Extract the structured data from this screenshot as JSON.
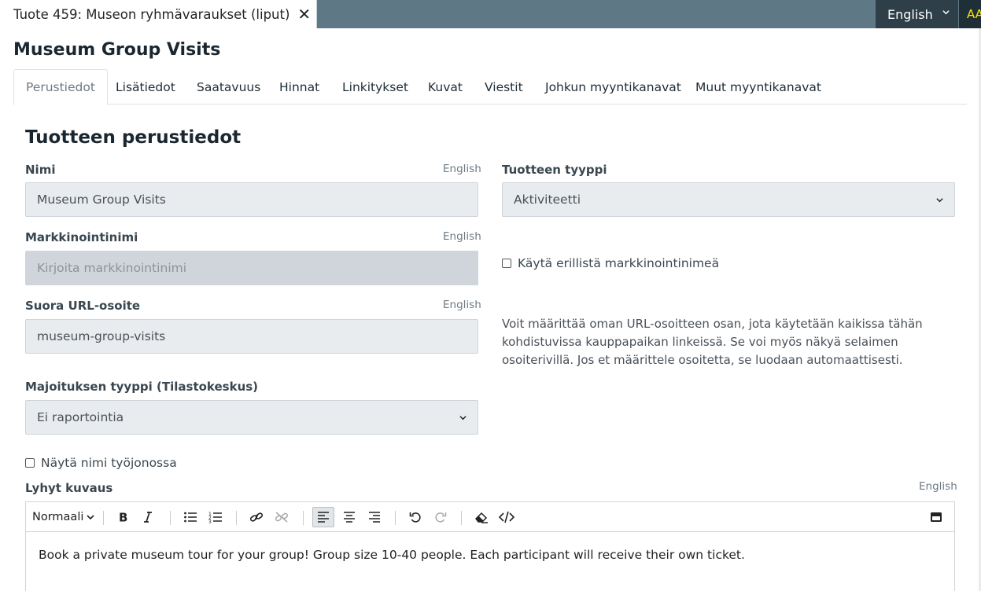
{
  "window": {
    "tab_title": "Tuote 459: Museon ryhmävaraukset (liput)",
    "tab_close_icon": "close-icon",
    "language": "English",
    "user_initials": "AA"
  },
  "page": {
    "title": "Museum Group Visits",
    "tabs": [
      {
        "label": "Perustiedot",
        "active": true
      },
      {
        "label": "Lisätiedot"
      },
      {
        "label": "Saatavuus"
      },
      {
        "label": "Hinnat"
      },
      {
        "label": "Linkitykset"
      },
      {
        "label": "Kuvat"
      },
      {
        "label": "Viestit"
      },
      {
        "label": "Johkun myyntikanavat"
      },
      {
        "label": "Muut myyntikanavat"
      }
    ]
  },
  "form": {
    "section_title": "Tuotteen perustiedot",
    "name": {
      "label": "Nimi",
      "lang": "English",
      "value": "Museum Group Visits"
    },
    "product_type": {
      "label": "Tuotteen tyyppi",
      "value": "Aktiviteetti"
    },
    "marketing_name": {
      "label": "Markkinointinimi",
      "lang": "English",
      "placeholder": "Kirjoita markkinointinimi"
    },
    "use_marketing_name": {
      "label": "Käytä erillistä markkinointinimeä",
      "checked": false
    },
    "url": {
      "label": "Suora URL-osoite",
      "lang": "English",
      "value": "museum-group-visits"
    },
    "url_help": "Voit määrittää oman URL-osoitteen osan, jota käytetään kaikissa tähän kohdistuvissa kauppapaikan linkeissä. Se voi myös näkyä selaimen osoiterivillä. Jos et määrittele osoitetta, se luodaan automaattisesti.",
    "accommodation_type": {
      "label": "Majoituksen tyyppi (Tilastokeskus)",
      "value": "Ei raportointia"
    },
    "show_name_in_queue": {
      "label": "Näytä nimi työjonossa",
      "checked": false
    },
    "short_description": {
      "label": "Lyhyt kuvaus",
      "lang": "English",
      "paragraph_style": "Normaali",
      "content": "Book a private museum tour for your group! Group size 10-40 people. Each participant will receive their own ticket."
    }
  },
  "colors": {
    "topbar": "#5f7885",
    "language_switch": "#2e3f49",
    "avatar_text": "#ffe600",
    "field_background": "#e9ecef"
  }
}
